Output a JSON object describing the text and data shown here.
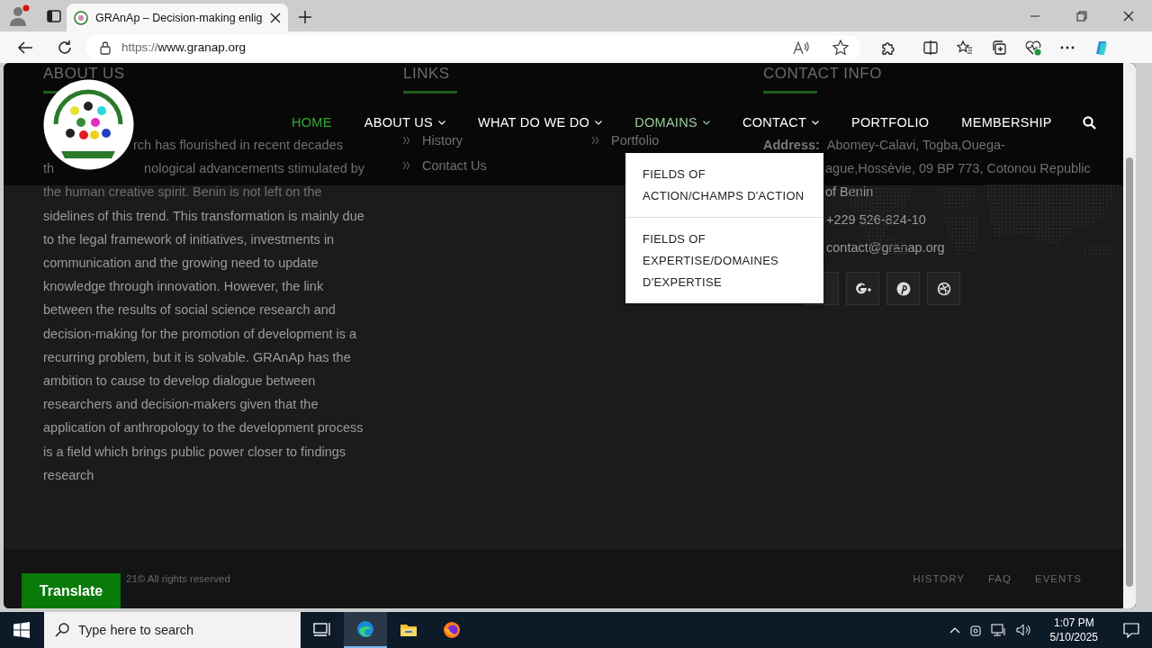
{
  "browser": {
    "tab_title": "GRAnAp – Decision-making enlig",
    "url_scheme": "https://",
    "url_host": "www.granap.org"
  },
  "footer": {
    "about": {
      "heading": "ABOUT US",
      "lead_line_1": "rch has flourished in recent decades",
      "lead_line_2a": "th",
      "lead_line_2b": "nological advancements stimulated by",
      "lead_line_3": "the human creative spirit. Benin is not left on the",
      "text": "sidelines of this trend. This transformation is mainly due to the legal framework of initiatives, investments in communication and the growing need to update knowledge through innovation. However, the link between the results of social science research and decision-making for the promotion of development is a recurring problem, but it is solvable. GRAnAp has the ambition to cause to develop dialogue between researchers and decision-makers given that the application of anthropology to the development process is a field which brings public power closer to findings research"
    },
    "links": {
      "heading": "LINKS",
      "items": [
        {
          "label": "History"
        },
        {
          "label": "Contact Us"
        },
        {
          "label": "Portfolio"
        }
      ]
    },
    "contact": {
      "heading": "CONTACT INFO",
      "address_label": "Address:",
      "address_1": "Abomey-Calavi, Togba,Ouega-",
      "address_2": "ague,Hossèvie, 09 BP 773, Cotonou Republic",
      "address_3": "of Benin",
      "phone": "+229 526-824-10",
      "email": "contact@granap.org",
      "social": [
        {
          "kind": "blank"
        },
        {
          "kind": "googleplus"
        },
        {
          "kind": "pinterest"
        },
        {
          "kind": "dribbble"
        }
      ]
    },
    "copyright": "21© All rights reserved",
    "bottom_links": [
      "HISTORY",
      "FAQ",
      "EVENTS"
    ],
    "translate": "Translate"
  },
  "nav": [
    {
      "label": "HOME",
      "has_menu": false,
      "selected": true,
      "expanded": false
    },
    {
      "label": "ABOUT US",
      "has_menu": true,
      "selected": false,
      "expanded": false
    },
    {
      "label": "WHAT DO WE DO",
      "has_menu": true,
      "selected": false,
      "expanded": false
    },
    {
      "label": "DOMAINS",
      "has_menu": true,
      "selected": false,
      "expanded": true,
      "menu": [
        "FIELDS OF ACTION/CHAMPS D'ACTION",
        "FIELDS OF EXPERTISE/DOMAINES D'EXPERTISE"
      ]
    },
    {
      "label": "CONTACT",
      "has_menu": true,
      "selected": false,
      "expanded": false
    },
    {
      "label": "PORTFOLIO",
      "has_menu": false,
      "selected": false,
      "expanded": false
    },
    {
      "label": "MEMBERSHIP",
      "has_menu": false,
      "selected": false,
      "expanded": false
    }
  ],
  "taskbar": {
    "search_placeholder": "Type here to search",
    "apps": [
      {
        "kind": "taskview",
        "active": false
      },
      {
        "kind": "edge",
        "active": true
      },
      {
        "kind": "explorer",
        "active": false
      },
      {
        "kind": "firefox",
        "active": false
      }
    ],
    "time": "1:07 PM",
    "date": "5/10/2025"
  }
}
